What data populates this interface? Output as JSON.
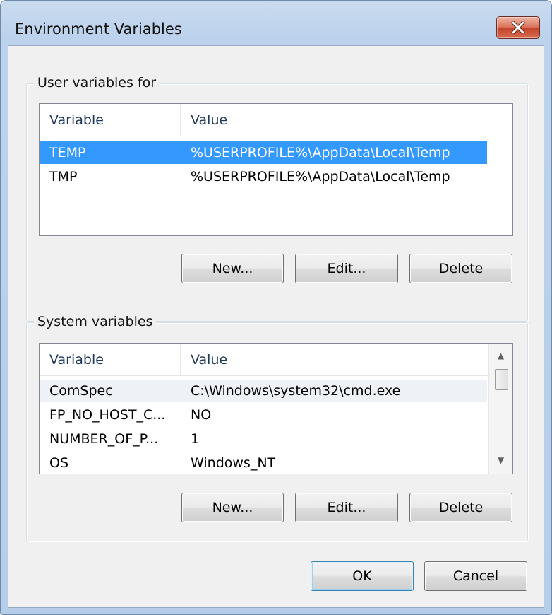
{
  "window": {
    "title": "Environment Variables",
    "close_icon": "close-x-icon"
  },
  "user_variables": {
    "label": "User variables for",
    "columns": [
      "Variable",
      "Value"
    ],
    "rows": [
      {
        "variable": "TEMP",
        "value": "%USERPROFILE%\\AppData\\Local\\Temp",
        "selected": true
      },
      {
        "variable": "TMP",
        "value": "%USERPROFILE%\\AppData\\Local\\Temp",
        "selected": false
      }
    ],
    "buttons": {
      "new": "New...",
      "edit": "Edit...",
      "delete": "Delete"
    }
  },
  "system_variables": {
    "label": "System variables",
    "columns": [
      "Variable",
      "Value"
    ],
    "rows": [
      {
        "variable": "ComSpec",
        "value": "C:\\Windows\\system32\\cmd.exe"
      },
      {
        "variable": "FP_NO_HOST_C...",
        "value": "NO"
      },
      {
        "variable": "NUMBER_OF_P...",
        "value": "1"
      },
      {
        "variable": "OS",
        "value": "Windows_NT"
      }
    ],
    "scrollbar": {
      "up_icon": "scroll-up-arrow-icon",
      "down_icon": "scroll-down-arrow-icon"
    },
    "buttons": {
      "new": "New...",
      "edit": "Edit...",
      "delete": "Delete"
    }
  },
  "dialog_buttons": {
    "ok": "OK",
    "cancel": "Cancel"
  },
  "colors": {
    "selection": "#3399ff",
    "selection_text": "#ffffff",
    "close_button": "#c7452c",
    "dialog_background": "#f0f0f0",
    "frame": "#bcd2ec"
  }
}
